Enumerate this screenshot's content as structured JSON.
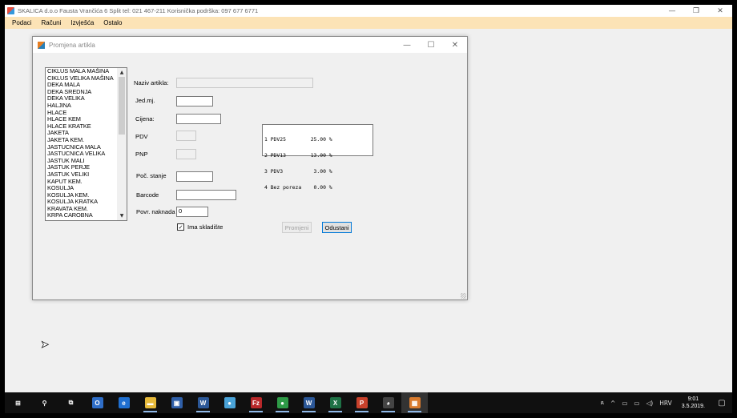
{
  "app": {
    "title": "SKALICA d.o.o Fausta Vrančića 6 Split  tel: 021 467-211  Korisnička podrška: 097 677 6771",
    "minimize": "—",
    "maximize": "❐",
    "close": "✕"
  },
  "menu": [
    "Podaci",
    "Računi",
    "Izvješća",
    "Ostalo"
  ],
  "dialog": {
    "title": "Promjena artikla",
    "minimize": "—",
    "maximize": "☐",
    "close": "✕",
    "articles": [
      "CIKLUS MALA MAŠINA",
      "CIKLUS VELIKA MAŠINA",
      "DEKA MALA",
      "DEKA SREDNJA",
      "DEKA VELIKA",
      "HALJINA",
      "HLACE",
      "HLACE KEM",
      "HLACE KRATKE",
      "JAKETA",
      "JAKETA KEM.",
      "JASTUCNICA MALA",
      "JASTUCNICA VELIKA",
      "JASTUK MALI",
      "JASTUK PERJE",
      "JASTUK VELIKI",
      "KAPUT KEM.",
      "KOSULJA",
      "KOSULJA KEM.",
      "KOSULJA KRATKA",
      "KRAVATA KEM.",
      "KRPA CAROBNA"
    ],
    "scroll_up": "▲",
    "scroll_down": "▼",
    "labels": {
      "naziv": "Naziv artikla:",
      "jedmj": "Jed.mj.",
      "cijena": "Cijena:",
      "pdv": "PDV",
      "pnp": "PNP",
      "poc_stanje": "Poč. stanje",
      "barcode": "Barcode",
      "povr_naknada": "Povr. naknada",
      "ima_skladiste": "Ima skladište"
    },
    "fields": {
      "naziv": "",
      "jedmj": "",
      "cijena": "",
      "pdv": "",
      "pnp": "",
      "poc_stanje": "",
      "barcode": "",
      "povr_naknada": "0"
    },
    "ima_skladiste_checked": true,
    "check_mark": "✓",
    "pdv_rates": [
      "1 PDV25        25.00 %",
      "2 PDV13        13.00 %",
      "3 PDV3          3.00 %",
      "4 Bez poreza    0.00 %"
    ],
    "buttons": {
      "promjeni": "Promjeni",
      "odustani": "Odustani"
    }
  },
  "taskbar": {
    "apps": [
      {
        "name": "start",
        "glyph": "⊞",
        "color": "#101010"
      },
      {
        "name": "search",
        "glyph": "⚲",
        "color": "#101010"
      },
      {
        "name": "task-view",
        "glyph": "⧉",
        "color": "#101010"
      },
      {
        "name": "outlook",
        "glyph": "O",
        "color": "#2f6ec8"
      },
      {
        "name": "edge",
        "glyph": "e",
        "color": "#1f6fd0"
      },
      {
        "name": "file-explorer",
        "glyph": "▬",
        "color": "#e6b93a"
      },
      {
        "name": "store",
        "glyph": "▣",
        "color": "#2f5fa8"
      },
      {
        "name": "word",
        "glyph": "W",
        "color": "#2b5797"
      },
      {
        "name": "paint",
        "glyph": "●",
        "color": "#4aa3d8"
      },
      {
        "name": "filezilla",
        "glyph": "Fz",
        "color": "#b8282a"
      },
      {
        "name": "chrome",
        "glyph": "●",
        "color": "#2e9a47"
      },
      {
        "name": "word-2",
        "glyph": "W",
        "color": "#2b5797"
      },
      {
        "name": "excel",
        "glyph": "X",
        "color": "#1e7145"
      },
      {
        "name": "powerpoint",
        "glyph": "P",
        "color": "#c8412b"
      },
      {
        "name": "panda",
        "glyph": "◕",
        "color": "#444444"
      },
      {
        "name": "skalica-app",
        "glyph": "▦",
        "color": "#d97b2e"
      }
    ],
    "tray": [
      "ጸ",
      "^",
      "▭",
      "▭",
      "◁)",
      "HRV"
    ],
    "time": "9:01",
    "date": "3.5.2019.",
    "notifications": "▢"
  }
}
